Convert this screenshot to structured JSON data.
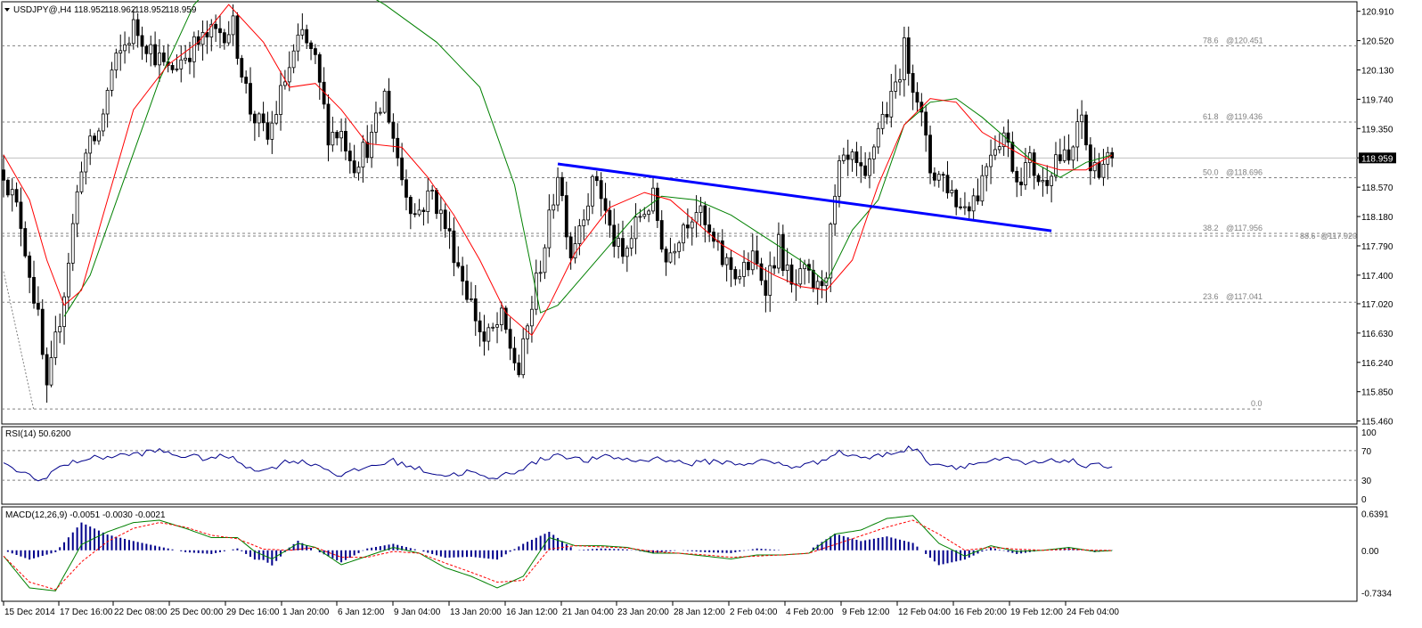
{
  "chart_data": {
    "type": "candlestick",
    "header": {
      "symbol": "USDJPY@,H4",
      "open": "118.952",
      "high": "118.962",
      "low": "118.952",
      "close": "118.959"
    },
    "price_axis": {
      "ticks": [
        "120.910",
        "120.520",
        "120.130",
        "119.740",
        "119.350",
        "118.960",
        "118.570",
        "118.180",
        "117.790",
        "117.400",
        "117.020",
        "116.630",
        "116.240",
        "115.850",
        "115.460"
      ],
      "range": [
        115.42,
        121.06
      ],
      "current": "118.959"
    },
    "time_axis": {
      "labels": [
        "15 Dec 2014",
        "17 Dec 16:00",
        "22 Dec 08:00",
        "25 Dec 00:00",
        "29 Dec 16:00",
        "1 Jan 20:00",
        "6 Jan 12:00",
        "9 Jan 04:00",
        "13 Jan 20:00",
        "16 Jan 12:00",
        "21 Jan 04:00",
        "23 Jan 20:00",
        "28 Jan 12:00",
        "2 Feb 04:00",
        "4 Feb 20:00",
        "9 Feb 12:00",
        "12 Feb 04:00",
        "16 Feb 20:00",
        "19 Feb 12:00",
        "24 Feb 04:00"
      ]
    },
    "fibonacci": [
      {
        "level": "78.6",
        "price": "@120.451",
        "value": 120.451
      },
      {
        "level": "61.8",
        "price": "@119.436",
        "value": 119.436
      },
      {
        "level": "50.0",
        "price": "@118.696",
        "value": 118.696
      },
      {
        "level": "38.2",
        "price": "@117.956",
        "value": 117.956
      },
      {
        "level": "23.6",
        "price": "@117.041",
        "value": 117.041
      },
      {
        "level": "0.0",
        "price": "",
        "value": 115.62
      }
    ],
    "fib_extra": {
      "level": "88.6",
      "price": "@117.920",
      "value": 117.92
    },
    "top_line": 121.03,
    "trendline": {
      "color": "#0000ff",
      "start": {
        "index": 128,
        "price": 118.88
      },
      "end": {
        "index": 242,
        "price": 117.99
      }
    },
    "anchors": [
      [
        0,
        118.8
      ],
      [
        4,
        118.1
      ],
      [
        8,
        116.8
      ],
      [
        10,
        115.8
      ],
      [
        14,
        117.2
      ],
      [
        18,
        118.9
      ],
      [
        22,
        119.3
      ],
      [
        25,
        120.1
      ],
      [
        30,
        120.7
      ],
      [
        33,
        120.5
      ],
      [
        38,
        120.1
      ],
      [
        43,
        120.4
      ],
      [
        48,
        120.6
      ],
      [
        53,
        120.7
      ],
      [
        57,
        119.6
      ],
      [
        61,
        119.2
      ],
      [
        65,
        120.0
      ],
      [
        69,
        120.6
      ],
      [
        72,
        120.2
      ],
      [
        75,
        119.3
      ],
      [
        78,
        119.3
      ],
      [
        81,
        118.9
      ],
      [
        85,
        119.2
      ],
      [
        88,
        119.8
      ],
      [
        92,
        118.7
      ],
      [
        95,
        118.2
      ],
      [
        99,
        118.5
      ],
      [
        103,
        117.9
      ],
      [
        107,
        117.2
      ],
      [
        111,
        116.5
      ],
      [
        115,
        116.8
      ],
      [
        119,
        116.1
      ],
      [
        123,
        117.3
      ],
      [
        126,
        118.1
      ],
      [
        128,
        118.8
      ],
      [
        131,
        117.7
      ],
      [
        134,
        118.3
      ],
      [
        137,
        118.7
      ],
      [
        140,
        118.0
      ],
      [
        143,
        117.6
      ],
      [
        147,
        118.2
      ],
      [
        150,
        118.4
      ],
      [
        153,
        117.6
      ],
      [
        157,
        118.1
      ],
      [
        160,
        118.3
      ],
      [
        163,
        117.9
      ],
      [
        166,
        117.6
      ],
      [
        170,
        117.4
      ],
      [
        173,
        117.6
      ],
      [
        176,
        117.3
      ],
      [
        179,
        117.8
      ],
      [
        182,
        117.2
      ],
      [
        185,
        117.4
      ],
      [
        188,
        117.2
      ],
      [
        190,
        117.5
      ],
      [
        193,
        118.8
      ],
      [
        196,
        118.9
      ],
      [
        199,
        118.6
      ],
      [
        202,
        119.4
      ],
      [
        205,
        119.7
      ],
      [
        208,
        120.4
      ],
      [
        211,
        119.8
      ],
      [
        214,
        118.8
      ],
      [
        217,
        118.7
      ],
      [
        221,
        118.3
      ],
      [
        225,
        118.5
      ],
      [
        228,
        119.1
      ],
      [
        231,
        119.3
      ],
      [
        234,
        118.7
      ],
      [
        237,
        118.9
      ],
      [
        240,
        118.6
      ],
      [
        243,
        119.0
      ],
      [
        246,
        118.9
      ],
      [
        249,
        119.5
      ],
      [
        251,
        118.8
      ],
      [
        254,
        118.9
      ],
      [
        256,
        118.96
      ]
    ],
    "ma_fast": {
      "color": "#ff0000",
      "points": [
        [
          0,
          119.0
        ],
        [
          6,
          118.4
        ],
        [
          10,
          117.6
        ],
        [
          14,
          117.0
        ],
        [
          18,
          117.2
        ],
        [
          24,
          118.4
        ],
        [
          30,
          119.6
        ],
        [
          38,
          120.2
        ],
        [
          45,
          120.5
        ],
        [
          52,
          121.0
        ],
        [
          60,
          120.5
        ],
        [
          66,
          119.9
        ],
        [
          72,
          119.95
        ],
        [
          78,
          119.6
        ],
        [
          84,
          119.15
        ],
        [
          92,
          119.1
        ],
        [
          98,
          118.7
        ],
        [
          104,
          118.2
        ],
        [
          110,
          117.6
        ],
        [
          116,
          116.9
        ],
        [
          122,
          116.6
        ],
        [
          126,
          117.0
        ],
        [
          132,
          117.7
        ],
        [
          140,
          118.3
        ],
        [
          148,
          118.5
        ],
        [
          154,
          118.4
        ],
        [
          160,
          118.1
        ],
        [
          166,
          117.8
        ],
        [
          172,
          117.6
        ],
        [
          178,
          117.4
        ],
        [
          184,
          117.25
        ],
        [
          190,
          117.2
        ],
        [
          196,
          117.6
        ],
        [
          202,
          118.6
        ],
        [
          208,
          119.4
        ],
        [
          214,
          119.75
        ],
        [
          220,
          119.7
        ],
        [
          226,
          119.3
        ],
        [
          232,
          119.1
        ],
        [
          238,
          118.9
        ],
        [
          244,
          118.8
        ],
        [
          250,
          118.8
        ],
        [
          256,
          119.0
        ]
      ]
    },
    "ma_slow": {
      "color": "#008000",
      "points": [
        [
          14,
          116.85
        ],
        [
          20,
          117.4
        ],
        [
          28,
          118.7
        ],
        [
          36,
          120.0
        ],
        [
          44,
          121.0
        ],
        [
          54,
          121.6
        ],
        [
          64,
          121.7
        ],
        [
          76,
          121.4
        ],
        [
          88,
          121.0
        ],
        [
          100,
          120.5
        ],
        [
          110,
          119.9
        ],
        [
          118,
          118.6
        ],
        [
          124,
          116.9
        ],
        [
          128,
          117.0
        ],
        [
          134,
          117.4
        ],
        [
          140,
          117.8
        ],
        [
          146,
          118.2
        ],
        [
          152,
          118.45
        ],
        [
          160,
          118.4
        ],
        [
          168,
          118.2
        ],
        [
          176,
          117.9
        ],
        [
          184,
          117.6
        ],
        [
          190,
          117.3
        ],
        [
          196,
          118.0
        ],
        [
          202,
          118.4
        ],
        [
          208,
          119.4
        ],
        [
          214,
          119.7
        ],
        [
          220,
          119.75
        ],
        [
          226,
          119.5
        ],
        [
          232,
          119.2
        ],
        [
          238,
          118.9
        ],
        [
          244,
          118.7
        ],
        [
          250,
          118.9
        ],
        [
          256,
          119.0
        ]
      ]
    },
    "rsi": {
      "label": "RSI(14) 50.6200",
      "axis_labels": [
        "100",
        "70",
        "30",
        "0"
      ],
      "levels": [
        70,
        30
      ],
      "anchors": [
        [
          0,
          50
        ],
        [
          5,
          40
        ],
        [
          8,
          28
        ],
        [
          12,
          45
        ],
        [
          18,
          58
        ],
        [
          24,
          62
        ],
        [
          30,
          65
        ],
        [
          36,
          70
        ],
        [
          40,
          64
        ],
        [
          46,
          60
        ],
        [
          52,
          62
        ],
        [
          56,
          50
        ],
        [
          60,
          42
        ],
        [
          66,
          57
        ],
        [
          72,
          52
        ],
        [
          78,
          36
        ],
        [
          84,
          48
        ],
        [
          90,
          56
        ],
        [
          96,
          45
        ],
        [
          102,
          36
        ],
        [
          108,
          42
        ],
        [
          112,
          30
        ],
        [
          118,
          42
        ],
        [
          124,
          57
        ],
        [
          128,
          66
        ],
        [
          134,
          56
        ],
        [
          140,
          62
        ],
        [
          146,
          56
        ],
        [
          152,
          60
        ],
        [
          158,
          52
        ],
        [
          164,
          56
        ],
        [
          170,
          52
        ],
        [
          176,
          56
        ],
        [
          182,
          48
        ],
        [
          188,
          54
        ],
        [
          192,
          68
        ],
        [
          196,
          64
        ],
        [
          200,
          60
        ],
        [
          206,
          68
        ],
        [
          210,
          74
        ],
        [
          214,
          54
        ],
        [
          220,
          48
        ],
        [
          226,
          54
        ],
        [
          232,
          58
        ],
        [
          236,
          52
        ],
        [
          240,
          54
        ],
        [
          246,
          58
        ],
        [
          250,
          48
        ],
        [
          256,
          50.6
        ]
      ]
    },
    "macd": {
      "label": "MACD(12,26,9) -0.0051 -0.0030 -0.0021",
      "axis_labels": [
        "0.6391",
        "0.00",
        "-0.7334"
      ],
      "range": [
        -0.85,
        0.72
      ],
      "macd_color": "#008000",
      "signal_color": "#ff0000",
      "hist_color": "#00008b",
      "macd_anchors": [
        [
          0,
          -0.1
        ],
        [
          6,
          -0.65
        ],
        [
          12,
          -0.7
        ],
        [
          18,
          0.1
        ],
        [
          24,
          0.32
        ],
        [
          30,
          0.48
        ],
        [
          36,
          0.52
        ],
        [
          42,
          0.38
        ],
        [
          48,
          0.22
        ],
        [
          54,
          0.22
        ],
        [
          58,
          -0.02
        ],
        [
          62,
          -0.15
        ],
        [
          68,
          0.12
        ],
        [
          72,
          0.05
        ],
        [
          78,
          -0.25
        ],
        [
          84,
          -0.1
        ],
        [
          90,
          0.05
        ],
        [
          96,
          -0.05
        ],
        [
          102,
          -0.3
        ],
        [
          108,
          -0.45
        ],
        [
          114,
          -0.65
        ],
        [
          120,
          -0.45
        ],
        [
          126,
          0.22
        ],
        [
          132,
          0.08
        ],
        [
          138,
          0.08
        ],
        [
          144,
          0.05
        ],
        [
          150,
          -0.05
        ],
        [
          156,
          -0.05
        ],
        [
          162,
          -0.1
        ],
        [
          168,
          -0.15
        ],
        [
          174,
          -0.08
        ],
        [
          180,
          -0.08
        ],
        [
          186,
          -0.05
        ],
        [
          192,
          0.28
        ],
        [
          198,
          0.35
        ],
        [
          204,
          0.55
        ],
        [
          210,
          0.6
        ],
        [
          216,
          0.12
        ],
        [
          222,
          -0.1
        ],
        [
          228,
          0.08
        ],
        [
          234,
          -0.02
        ],
        [
          240,
          0.0
        ],
        [
          246,
          0.05
        ],
        [
          252,
          -0.02
        ],
        [
          256,
          -0.0051
        ]
      ],
      "signal_anchors": [
        [
          0,
          -0.1
        ],
        [
          6,
          -0.55
        ],
        [
          12,
          -0.68
        ],
        [
          18,
          -0.2
        ],
        [
          24,
          0.15
        ],
        [
          30,
          0.38
        ],
        [
          36,
          0.48
        ],
        [
          42,
          0.4
        ],
        [
          48,
          0.26
        ],
        [
          54,
          0.2
        ],
        [
          60,
          0.02
        ],
        [
          66,
          0.0
        ],
        [
          72,
          0.05
        ],
        [
          78,
          -0.12
        ],
        [
          84,
          -0.12
        ],
        [
          90,
          -0.02
        ],
        [
          96,
          -0.05
        ],
        [
          102,
          -0.22
        ],
        [
          108,
          -0.38
        ],
        [
          114,
          -0.55
        ],
        [
          120,
          -0.52
        ],
        [
          126,
          0.02
        ],
        [
          132,
          0.08
        ],
        [
          138,
          0.06
        ],
        [
          144,
          0.04
        ],
        [
          150,
          -0.02
        ],
        [
          156,
          -0.05
        ],
        [
          162,
          -0.08
        ],
        [
          168,
          -0.12
        ],
        [
          174,
          -0.1
        ],
        [
          180,
          -0.08
        ],
        [
          186,
          -0.05
        ],
        [
          192,
          0.1
        ],
        [
          198,
          0.25
        ],
        [
          204,
          0.4
        ],
        [
          210,
          0.52
        ],
        [
          216,
          0.28
        ],
        [
          222,
          0.0
        ],
        [
          228,
          0.05
        ],
        [
          234,
          0.02
        ],
        [
          240,
          0.0
        ],
        [
          246,
          0.02
        ],
        [
          252,
          0.0
        ],
        [
          256,
          -0.003
        ]
      ]
    }
  }
}
